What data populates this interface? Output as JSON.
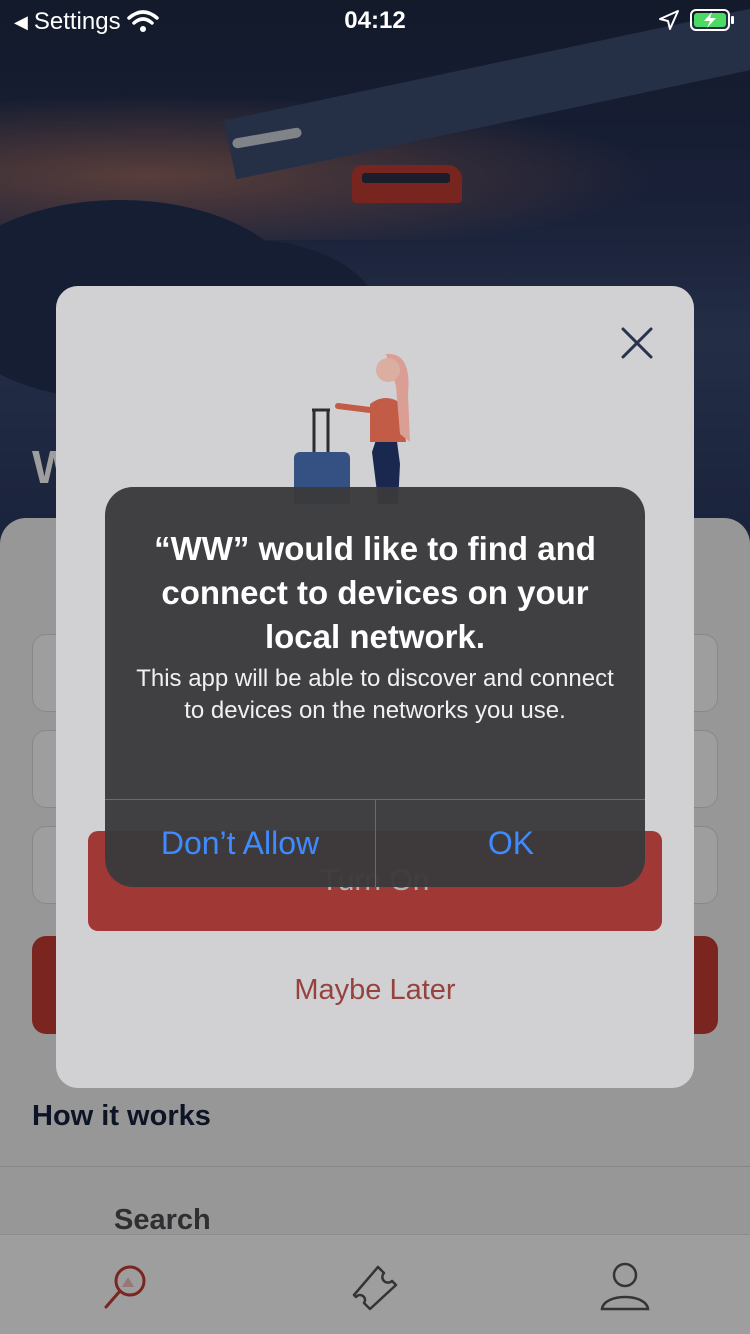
{
  "status_bar": {
    "back_label": "Settings",
    "time": "04:12"
  },
  "background": {
    "partial_heading": "W",
    "section_title": "How it works",
    "list_item": "Search"
  },
  "modal": {
    "primary_button": "Turn On",
    "secondary_button": "Maybe Later"
  },
  "alert": {
    "title": "“WW” would like to find and connect to devices on your local network.",
    "message": "This app will be able to discover and connect to devices on the networks you use.",
    "deny_button": "Don’t Allow",
    "ok_button": "OK"
  },
  "tabbar": {
    "tabs": [
      "search-icon",
      "ticket-icon",
      "profile-icon"
    ]
  },
  "colors": {
    "accent": "#c63c34",
    "alert_button": "#3e8bff"
  }
}
